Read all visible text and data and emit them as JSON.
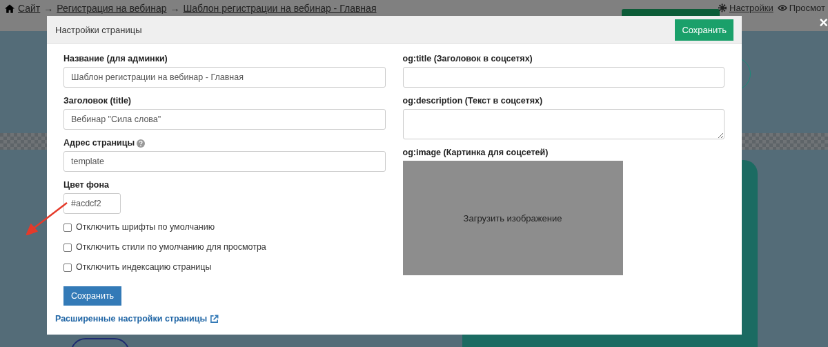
{
  "top_bar": {
    "breadcrumb": [
      "Сайт",
      "Регистрация на вебинар",
      "Шаблон регистрации на вебинар - Главная"
    ],
    "separator": "→",
    "links": [
      "Настройки",
      "Просмот"
    ],
    "close": "×"
  },
  "modal": {
    "title": "Настройки страницы",
    "header_button": "Сохранить",
    "left_fields": [
      {
        "kind": "input",
        "label": "Название (для админки)",
        "value": "Шаблон регистрации на вебинар - Главная",
        "help": false
      },
      {
        "kind": "input",
        "label": "Заголовок (title)",
        "value": "Вебинар \"Сила слова\"",
        "help": false
      },
      {
        "kind": "input",
        "label": "Адрес страницы",
        "value": "template",
        "help": true
      },
      {
        "kind": "color",
        "label": "Цвет фона",
        "value": "#acdcf2",
        "help": false
      }
    ],
    "checkboxes": [
      {
        "label": "Отключить шрифты по умолчанию",
        "checked": false
      },
      {
        "label": "Отключить стили по умолчанию для просмотра",
        "checked": false
      },
      {
        "label": "Отключить индексацию страницы",
        "checked": false
      }
    ],
    "save_button": "Сохранить",
    "advanced_link": "Расширенные настройки страницы",
    "right_fields": [
      {
        "kind": "input",
        "label": "og:title (Заголовок в соцсетях)"
      },
      {
        "kind": "textarea",
        "label": "og:description (Текст в соцсетях)"
      },
      {
        "kind": "image",
        "label": "og:image (Картинка для соцсетей)",
        "upload": "Загрузить изображение"
      }
    ]
  }
}
